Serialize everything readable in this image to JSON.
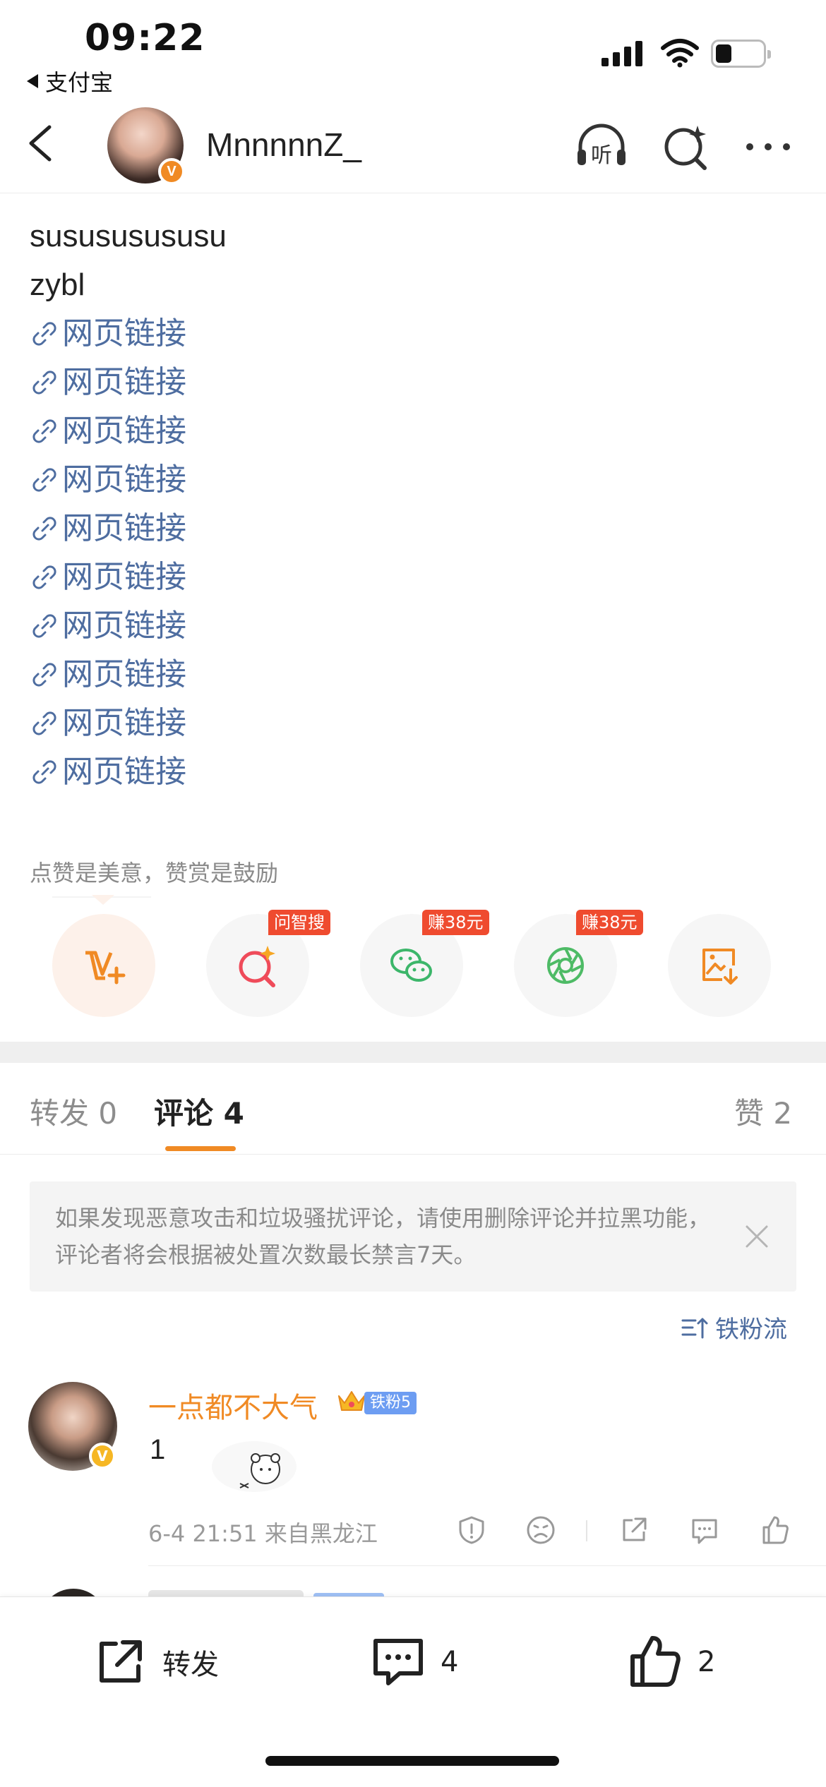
{
  "status_bar": {
    "time": "09:22",
    "back_app": "支付宝"
  },
  "header": {
    "user_name": "MnnnnnZ_",
    "icons": [
      "back-icon",
      "listen-icon",
      "ai-search-icon",
      "more-icon"
    ],
    "listen_label": "听"
  },
  "post": {
    "lines": [
      "susususususu",
      "zybl"
    ],
    "links": [
      "网页链接",
      "网页链接",
      "网页链接",
      "网页链接",
      "网页链接",
      "网页链接",
      "网页链接",
      "网页链接",
      "网页链接",
      "网页链接"
    ]
  },
  "reward": {
    "tip": "点赞是美意，赞赏是鼓励",
    "buttons": [
      {
        "icon": "v-plus-icon",
        "tag": ""
      },
      {
        "icon": "ai-search-icon",
        "tag": "问智搜"
      },
      {
        "icon": "wechat-icon",
        "tag": "赚38元"
      },
      {
        "icon": "moments-icon",
        "tag": "赚38元"
      },
      {
        "icon": "save-image-icon",
        "tag": ""
      }
    ]
  },
  "tabs": {
    "repost": "转发 0",
    "comment": "评论 4",
    "like": "赞 2"
  },
  "notice": {
    "text": "如果发现恶意攻击和垃圾骚扰评论，请使用删除评论并拉黑功能，评论者将会根据被处置次数最长禁言7天。"
  },
  "sort": {
    "label": "铁粉流"
  },
  "comments": [
    {
      "name": "一点都不大气",
      "fan_badge": "铁粉5",
      "text": "1",
      "meta": "6-4 21:51 来自黑龙江"
    }
  ],
  "bottom_bar": {
    "repost_label": "转发",
    "comment_count": "4",
    "like_count": "2"
  },
  "colors": {
    "accent_orange": "#f08a24",
    "link_blue": "#4e6da0",
    "tag_red": "#ef4b2f"
  }
}
